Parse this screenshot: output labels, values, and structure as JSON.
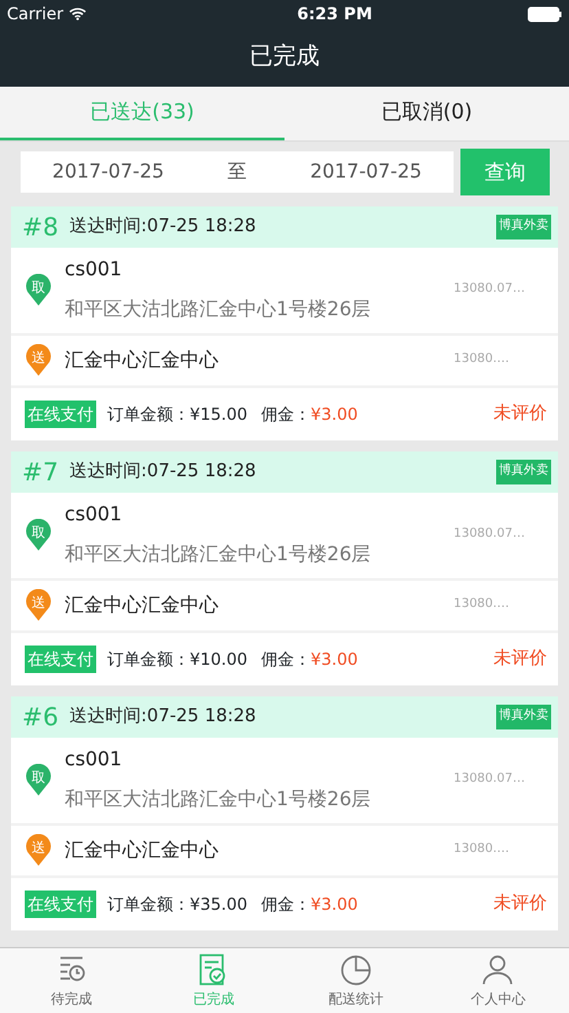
{
  "status_bar": {
    "carrier": "Carrier",
    "time": "6:23 PM"
  },
  "nav": {
    "title": "已完成"
  },
  "tabs": [
    {
      "label": "已送达(33)",
      "selected": true
    },
    {
      "label": "已取消(0)",
      "selected": false
    }
  ],
  "filter": {
    "start_date": "2017-07-25",
    "separator": "至",
    "end_date": "2017-07-25",
    "button": "查询"
  },
  "orders": [
    {
      "number": "#8",
      "delivered_time": "送达时间:07-25 18:28",
      "platform": "博真外卖",
      "pickup": {
        "badge": "取",
        "name": "cs001",
        "address": "和平区大沽北路汇金中心1号楼26层",
        "phone": "13080.07…"
      },
      "dropoff": {
        "badge": "送",
        "name": "汇金中心汇金中心",
        "phone": "13080.…"
      },
      "payment": "在线支付",
      "amount": "订单金额：¥15.00",
      "commission_label": "佣金：",
      "commission": "¥3.00",
      "rating": "未评价"
    },
    {
      "number": "#7",
      "delivered_time": "送达时间:07-25 18:28",
      "platform": "博真外卖",
      "pickup": {
        "badge": "取",
        "name": "cs001",
        "address": "和平区大沽北路汇金中心1号楼26层",
        "phone": "13080.07…"
      },
      "dropoff": {
        "badge": "送",
        "name": "汇金中心汇金中心",
        "phone": "13080.…"
      },
      "payment": "在线支付",
      "amount": "订单金额：¥10.00",
      "commission_label": "佣金：",
      "commission": "¥3.00",
      "rating": "未评价"
    },
    {
      "number": "#6",
      "delivered_time": "送达时间:07-25 18:28",
      "platform": "博真外卖",
      "pickup": {
        "badge": "取",
        "name": "cs001",
        "address": "和平区大沽北路汇金中心1号楼26层",
        "phone": "13080.07…"
      },
      "dropoff": {
        "badge": "送",
        "name": "汇金中心汇金中心",
        "phone": "13080.…"
      },
      "payment": "在线支付",
      "amount": "订单金额：¥35.00",
      "commission_label": "佣金：",
      "commission": "¥3.00",
      "rating": "未评价"
    }
  ],
  "tab_bar": [
    {
      "label": "待完成",
      "selected": false
    },
    {
      "label": "已完成",
      "selected": true
    },
    {
      "label": "配送统计",
      "selected": false
    },
    {
      "label": "个人中心",
      "selected": false
    }
  ]
}
